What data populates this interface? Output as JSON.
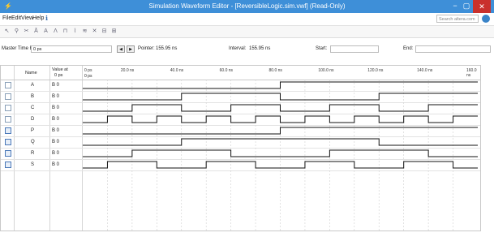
{
  "window": {
    "title": "Simulation Waveform Editor - [ReversibleLogic.sim.vwf] (Read-Only)",
    "minimize": "−",
    "maximize": "▢",
    "close": "✕"
  },
  "menubar": {
    "items": [
      "File",
      "Edit",
      "View",
      "Help"
    ],
    "search_placeholder": "Search altera.com"
  },
  "toolbar": {
    "icons": [
      "pointer-icon",
      "zoom-icon",
      "cut-icon",
      "high-icon",
      "low-icon",
      "invert-icon",
      "count-icon",
      "clock-icon",
      "random-icon",
      "weak-icon",
      "snap-icon",
      "grid-icon"
    ]
  },
  "timebar": {
    "master_label": "Master Time Bar:",
    "master_value": "0 ps",
    "pointer_label": "Pointer:",
    "pointer_value": "155.95 ns",
    "interval_label": "Interval:",
    "interval_value": "155.95 ns",
    "start_label": "Start:",
    "start_value": "",
    "end_label": "End:",
    "end_value": ""
  },
  "table": {
    "name_header": "Name",
    "value_header": "Value at",
    "value_sub": "0 ps",
    "cursor": "0 ps",
    "time_ticks": [
      "0 ps",
      "20.0 ns",
      "40.0 ns",
      "60.0 ns",
      "80.0 ns",
      "100.0 ns",
      "120.0 ns",
      "140.0 ns",
      "160.0 ns"
    ],
    "signals": [
      {
        "name": "A",
        "value": "B 0",
        "type": "input",
        "edges": [
          80
        ]
      },
      {
        "name": "B",
        "value": "B 0",
        "type": "input",
        "edges": [
          40,
          80,
          120
        ]
      },
      {
        "name": "C",
        "value": "B 0",
        "type": "input",
        "edges": [
          20,
          40,
          60,
          80,
          100,
          120,
          140
        ]
      },
      {
        "name": "D",
        "value": "B 0",
        "type": "input",
        "edges": [
          10,
          20,
          30,
          40,
          50,
          60,
          70,
          80,
          90,
          100,
          110,
          120,
          130,
          140,
          150
        ]
      },
      {
        "name": "P",
        "value": "B 0",
        "type": "output",
        "edges": [
          80
        ]
      },
      {
        "name": "Q",
        "value": "B 0",
        "type": "output",
        "edges": [
          40,
          120
        ]
      },
      {
        "name": "R",
        "value": "B 0",
        "type": "output",
        "edges": [
          20,
          60,
          100,
          140
        ]
      },
      {
        "name": "S",
        "value": "B 0",
        "type": "output",
        "edges": [
          10,
          30,
          50,
          70,
          90,
          110,
          130,
          150
        ]
      }
    ]
  }
}
